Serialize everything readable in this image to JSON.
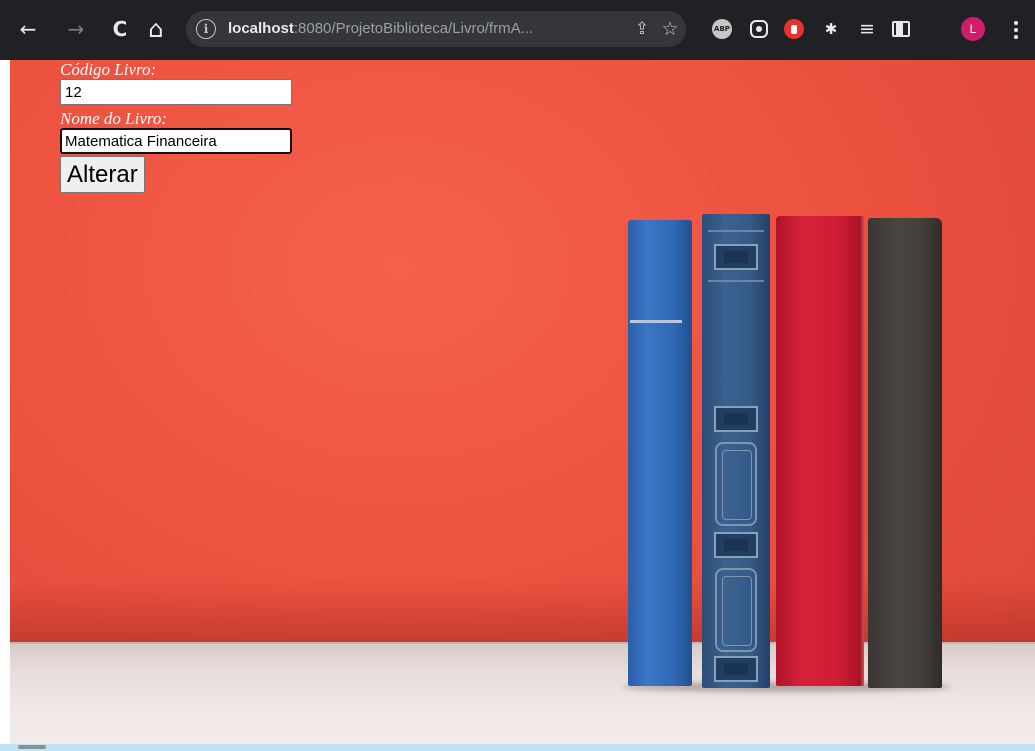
{
  "browser": {
    "nav": {
      "back_icon": "←",
      "forward_icon": "→",
      "reload_icon": "C",
      "home_icon": "⌂"
    },
    "omnibox": {
      "info_icon": "i",
      "url_host": "localhost",
      "url_rest": ":8080/ProjetoBiblioteca/Livro/frmA...",
      "share_icon": "⇪",
      "star_icon": "☆"
    },
    "extensions": {
      "abp_label": "ABP",
      "puzzle_icon": "✱",
      "reading_list_icon": "≡"
    },
    "profile_initial": "L"
  },
  "form": {
    "codigo_label": "Código Livro:",
    "codigo_value": "12",
    "nome_label": "Nome do Livro:",
    "nome_value": "Matematica Financeira",
    "submit_label": "Alterar"
  },
  "colors": {
    "wall": "#ee5240",
    "toolbar": "#202124",
    "avatar": "#d01d6b"
  }
}
